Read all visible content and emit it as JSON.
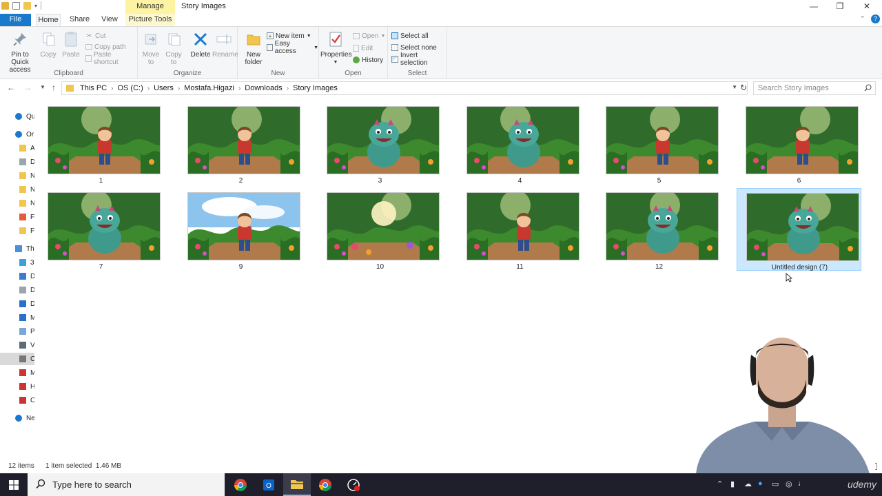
{
  "window": {
    "title": "Story Images",
    "manage_tab": "Manage",
    "controls": {
      "minimize": "—",
      "restore": "❐",
      "close": "✕"
    }
  },
  "ribbon_tabs": {
    "file": "File",
    "home": "Home",
    "share": "Share",
    "view": "View",
    "picture_tools": "Picture Tools"
  },
  "ribbon": {
    "clipboard": {
      "label": "Clipboard",
      "pin": "Pin to Quick access",
      "copy": "Copy",
      "paste": "Paste",
      "cut": "Cut",
      "copy_path": "Copy path",
      "paste_shortcut": "Paste shortcut"
    },
    "organize": {
      "label": "Organize",
      "move_to": "Move to",
      "copy_to": "Copy to",
      "delete": "Delete",
      "rename": "Rename"
    },
    "new": {
      "label": "New",
      "new_folder": "New folder",
      "new_item": "New item",
      "easy_access": "Easy access"
    },
    "open": {
      "label": "Open",
      "properties": "Properties",
      "open": "Open",
      "edit": "Edit",
      "history": "History"
    },
    "select": {
      "label": "Select",
      "select_all": "Select all",
      "select_none": "Select none",
      "invert_selection": "Invert selection"
    }
  },
  "address": {
    "crumbs": [
      "This PC",
      "OS (C:)",
      "Users",
      "Mostafa.Higazi",
      "Downloads",
      "Story Images"
    ],
    "search_placeholder": "Search Story Images"
  },
  "nav_pane": [
    {
      "label": "Qu",
      "icon": "star-icon"
    },
    {
      "label": "Or",
      "icon": "cloud-icon"
    },
    {
      "label": "A",
      "icon": "folder-icon"
    },
    {
      "label": "D",
      "icon": "document-icon"
    },
    {
      "label": "N",
      "icon": "folder-icon"
    },
    {
      "label": "N",
      "icon": "folder-icon"
    },
    {
      "label": "N",
      "icon": "folder-icon"
    },
    {
      "label": "F",
      "icon": "file-icon"
    },
    {
      "label": "F",
      "icon": "folder-icon"
    },
    {
      "label": "Th",
      "icon": "computer-icon"
    },
    {
      "label": "3",
      "icon": "cube-icon"
    },
    {
      "label": "D",
      "icon": "desktop-icon"
    },
    {
      "label": "D",
      "icon": "document-icon"
    },
    {
      "label": "D",
      "icon": "download-icon"
    },
    {
      "label": "M",
      "icon": "music-icon"
    },
    {
      "label": "P",
      "icon": "picture-icon"
    },
    {
      "label": "V",
      "icon": "video-icon"
    },
    {
      "label": "C",
      "icon": "drive-icon"
    },
    {
      "label": "M",
      "icon": "network-drive-icon"
    },
    {
      "label": "H",
      "icon": "network-drive-icon"
    },
    {
      "label": "C",
      "icon": "network-drive-icon"
    },
    {
      "label": "Ne",
      "icon": "network-icon"
    }
  ],
  "files": [
    {
      "name": "1",
      "subject": "boy"
    },
    {
      "name": "2",
      "subject": "boy"
    },
    {
      "name": "3",
      "subject": "dino"
    },
    {
      "name": "4",
      "subject": "dino"
    },
    {
      "name": "5",
      "subject": "boy"
    },
    {
      "name": "6",
      "subject": "boy"
    },
    {
      "name": "7",
      "subject": "dino"
    },
    {
      "name": "9",
      "subject": "boy-sky"
    },
    {
      "name": "10",
      "subject": "jungle"
    },
    {
      "name": "11",
      "subject": "boy"
    },
    {
      "name": "12",
      "subject": "dino"
    },
    {
      "name": "Untitled design (7)",
      "subject": "dino",
      "selected": true
    }
  ],
  "status": {
    "item_count": "12 items",
    "selection": "1 item selected  1.46 MB"
  },
  "taskbar": {
    "search_placeholder": "Type here to search",
    "watermark": "udemy"
  },
  "colors": {
    "accent": "#1979ca",
    "manage": "#fdf3a3",
    "selection": "#cce8ff",
    "selection_border": "#99d1ff",
    "taskbar": "#1f1f2b"
  }
}
